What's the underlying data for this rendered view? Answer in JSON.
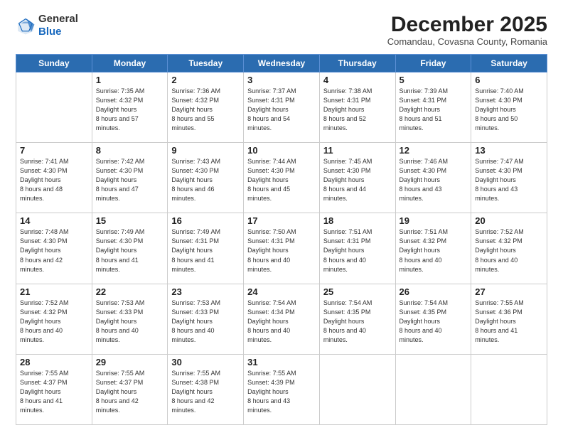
{
  "logo": {
    "general": "General",
    "blue": "Blue"
  },
  "header": {
    "month": "December 2025",
    "location": "Comandau, Covasna County, Romania"
  },
  "weekdays": [
    "Sunday",
    "Monday",
    "Tuesday",
    "Wednesday",
    "Thursday",
    "Friday",
    "Saturday"
  ],
  "weeks": [
    [
      {
        "day": "",
        "empty": true
      },
      {
        "day": "1",
        "sunrise": "7:35 AM",
        "sunset": "4:32 PM",
        "daylight": "8 hours and 57 minutes."
      },
      {
        "day": "2",
        "sunrise": "7:36 AM",
        "sunset": "4:32 PM",
        "daylight": "8 hours and 55 minutes."
      },
      {
        "day": "3",
        "sunrise": "7:37 AM",
        "sunset": "4:31 PM",
        "daylight": "8 hours and 54 minutes."
      },
      {
        "day": "4",
        "sunrise": "7:38 AM",
        "sunset": "4:31 PM",
        "daylight": "8 hours and 52 minutes."
      },
      {
        "day": "5",
        "sunrise": "7:39 AM",
        "sunset": "4:31 PM",
        "daylight": "8 hours and 51 minutes."
      },
      {
        "day": "6",
        "sunrise": "7:40 AM",
        "sunset": "4:30 PM",
        "daylight": "8 hours and 50 minutes."
      }
    ],
    [
      {
        "day": "7",
        "sunrise": "7:41 AM",
        "sunset": "4:30 PM",
        "daylight": "8 hours and 48 minutes."
      },
      {
        "day": "8",
        "sunrise": "7:42 AM",
        "sunset": "4:30 PM",
        "daylight": "8 hours and 47 minutes."
      },
      {
        "day": "9",
        "sunrise": "7:43 AM",
        "sunset": "4:30 PM",
        "daylight": "8 hours and 46 minutes."
      },
      {
        "day": "10",
        "sunrise": "7:44 AM",
        "sunset": "4:30 PM",
        "daylight": "8 hours and 45 minutes."
      },
      {
        "day": "11",
        "sunrise": "7:45 AM",
        "sunset": "4:30 PM",
        "daylight": "8 hours and 44 minutes."
      },
      {
        "day": "12",
        "sunrise": "7:46 AM",
        "sunset": "4:30 PM",
        "daylight": "8 hours and 43 minutes."
      },
      {
        "day": "13",
        "sunrise": "7:47 AM",
        "sunset": "4:30 PM",
        "daylight": "8 hours and 43 minutes."
      }
    ],
    [
      {
        "day": "14",
        "sunrise": "7:48 AM",
        "sunset": "4:30 PM",
        "daylight": "8 hours and 42 minutes."
      },
      {
        "day": "15",
        "sunrise": "7:49 AM",
        "sunset": "4:30 PM",
        "daylight": "8 hours and 41 minutes."
      },
      {
        "day": "16",
        "sunrise": "7:49 AM",
        "sunset": "4:31 PM",
        "daylight": "8 hours and 41 minutes."
      },
      {
        "day": "17",
        "sunrise": "7:50 AM",
        "sunset": "4:31 PM",
        "daylight": "8 hours and 40 minutes."
      },
      {
        "day": "18",
        "sunrise": "7:51 AM",
        "sunset": "4:31 PM",
        "daylight": "8 hours and 40 minutes."
      },
      {
        "day": "19",
        "sunrise": "7:51 AM",
        "sunset": "4:32 PM",
        "daylight": "8 hours and 40 minutes."
      },
      {
        "day": "20",
        "sunrise": "7:52 AM",
        "sunset": "4:32 PM",
        "daylight": "8 hours and 40 minutes."
      }
    ],
    [
      {
        "day": "21",
        "sunrise": "7:52 AM",
        "sunset": "4:32 PM",
        "daylight": "8 hours and 40 minutes."
      },
      {
        "day": "22",
        "sunrise": "7:53 AM",
        "sunset": "4:33 PM",
        "daylight": "8 hours and 40 minutes."
      },
      {
        "day": "23",
        "sunrise": "7:53 AM",
        "sunset": "4:33 PM",
        "daylight": "8 hours and 40 minutes."
      },
      {
        "day": "24",
        "sunrise": "7:54 AM",
        "sunset": "4:34 PM",
        "daylight": "8 hours and 40 minutes."
      },
      {
        "day": "25",
        "sunrise": "7:54 AM",
        "sunset": "4:35 PM",
        "daylight": "8 hours and 40 minutes."
      },
      {
        "day": "26",
        "sunrise": "7:54 AM",
        "sunset": "4:35 PM",
        "daylight": "8 hours and 40 minutes."
      },
      {
        "day": "27",
        "sunrise": "7:55 AM",
        "sunset": "4:36 PM",
        "daylight": "8 hours and 41 minutes."
      }
    ],
    [
      {
        "day": "28",
        "sunrise": "7:55 AM",
        "sunset": "4:37 PM",
        "daylight": "8 hours and 41 minutes."
      },
      {
        "day": "29",
        "sunrise": "7:55 AM",
        "sunset": "4:37 PM",
        "daylight": "8 hours and 42 minutes."
      },
      {
        "day": "30",
        "sunrise": "7:55 AM",
        "sunset": "4:38 PM",
        "daylight": "8 hours and 42 minutes."
      },
      {
        "day": "31",
        "sunrise": "7:55 AM",
        "sunset": "4:39 PM",
        "daylight": "8 hours and 43 minutes."
      },
      {
        "day": "",
        "empty": true
      },
      {
        "day": "",
        "empty": true
      },
      {
        "day": "",
        "empty": true
      }
    ]
  ]
}
